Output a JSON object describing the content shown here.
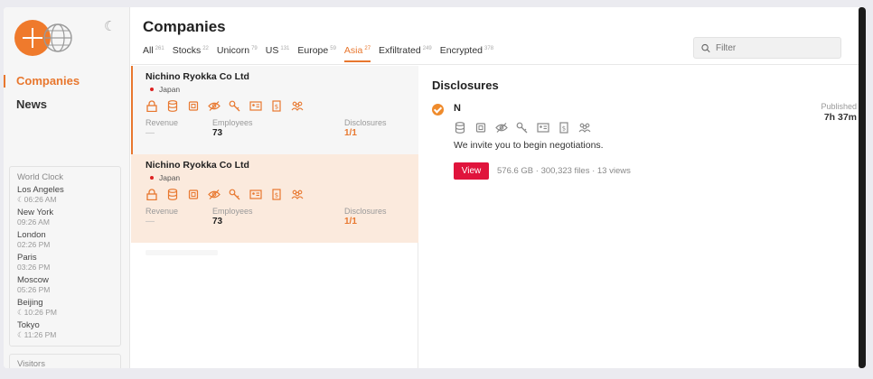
{
  "sidebar": {
    "nav": [
      "Companies",
      "News"
    ],
    "world_clock": {
      "title": "World Clock",
      "cities": [
        {
          "name": "Los Angeles",
          "time": "☾06:26 AM"
        },
        {
          "name": "New York",
          "time": "09:26 AM"
        },
        {
          "name": "London",
          "time": "02:26 PM"
        },
        {
          "name": "Paris",
          "time": "03:26 PM"
        },
        {
          "name": "Moscow",
          "time": "05:26 PM"
        },
        {
          "name": "Beijing",
          "time": "☾10:26 PM"
        },
        {
          "name": "Tokyo",
          "time": "☾11:26 PM"
        }
      ]
    },
    "visitors": "Visitors"
  },
  "header": {
    "title": "Companies",
    "tabs": [
      {
        "label": "All",
        "count": "261"
      },
      {
        "label": "Stocks",
        "count": "22"
      },
      {
        "label": "Unicorn",
        "count": "79"
      },
      {
        "label": "US",
        "count": "131"
      },
      {
        "label": "Europe",
        "count": "59"
      },
      {
        "label": "Asia",
        "count": "27"
      },
      {
        "label": "Exfiltrated",
        "count": "249"
      },
      {
        "label": "Encrypted",
        "count": "378"
      }
    ],
    "active_tab": "Asia",
    "filter_placeholder": "Filter"
  },
  "companies": [
    {
      "name": "Nichino Ryokka Co Ltd",
      "country": "Japan",
      "revenue_label": "Revenue",
      "revenue": "—",
      "employees_label": "Employees",
      "employees": "73",
      "disclosures_label": "Disclosures",
      "disclosures": "1/1"
    },
    {
      "name": "Nichino Ryokka Co Ltd",
      "country": "Japan",
      "revenue_label": "Revenue",
      "revenue": "—",
      "employees_label": "Employees",
      "employees": "73",
      "disclosures_label": "Disclosures",
      "disclosures": "1/1"
    }
  ],
  "detail": {
    "title": "Disclosures",
    "entry_name": "N",
    "published_label": "Published",
    "published_value": "7h 37m",
    "message": "We invite you to begin negotiations.",
    "view_button": "View",
    "meta": "576.6 GB · 300,323 files · 13 views"
  },
  "icons": [
    "lock-icon",
    "database-icon",
    "chip-icon",
    "eye-slash-icon",
    "key-icon",
    "id-card-icon",
    "document-dollar-icon",
    "users-icon"
  ],
  "colors": {
    "accent": "#e8772e",
    "view_button": "#e0143c",
    "selected_card": "#fbeadd",
    "country_dot": "#dd2222"
  }
}
